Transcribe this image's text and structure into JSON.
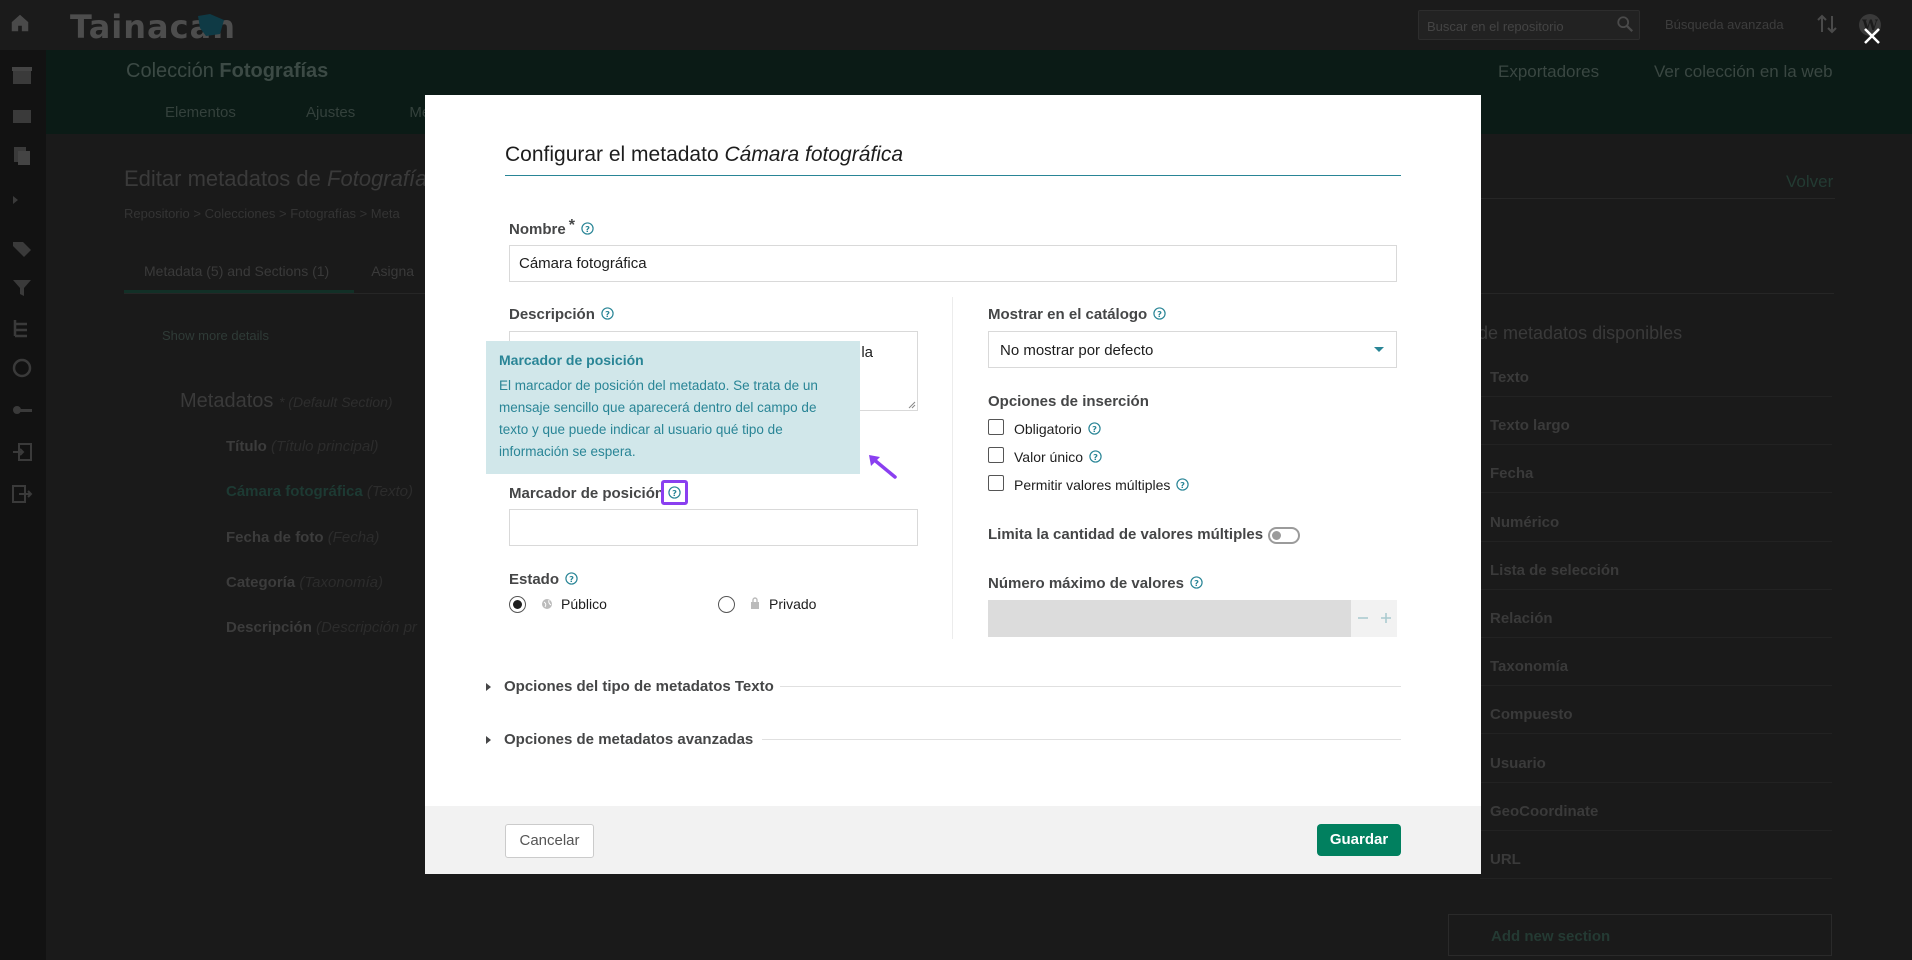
{
  "app": {
    "logo_text": "Tainacan",
    "search_placeholder": "Buscar en el repositorio",
    "advanced_search": "Búsqueda avanzada"
  },
  "collection": {
    "title_prefix": "Colección",
    "title_name": "Fotografías",
    "exporters": "Exportadores",
    "view_web": "Ver colección en la web",
    "tabs": [
      "Elementos",
      "Ajustes",
      "Me"
    ]
  },
  "page": {
    "title_prefix": "Editar metadatos de",
    "title_name": "Fotografía",
    "breadcrumb": "Repositorio  >  Colecciones  >  Fotografías  >  Meta",
    "tab_active": "Metadata (5) and Sections (1)",
    "tab_other": "Asigna",
    "show_more": "Show more details",
    "volver": "Volver",
    "metadata_heading": "Metadatos",
    "metadata_section": "* (Default Section)",
    "metadata_items": [
      {
        "name": "Título",
        "type": "(Título principal)"
      },
      {
        "name": "Cámara fotográfica",
        "type": "(Texto)"
      },
      {
        "name": "Fecha de foto",
        "type": "(Fecha)"
      },
      {
        "name": "Categoría",
        "type": "(Taxonomía)"
      },
      {
        "name": "Descripción",
        "type": "(Descripción pr"
      }
    ],
    "available_heading": "de metadatos disponibles",
    "available_types": [
      "Texto",
      "Texto largo",
      "Fecha",
      "Numérico",
      "Lista de selección",
      "Relación",
      "Taxonomía",
      "Compuesto",
      "Usuario",
      "GeoCoordinate",
      "URL"
    ],
    "add_section": "Add new section"
  },
  "modal": {
    "title_prefix": "Configurar el metadato",
    "title_name": "Cámara fotográfica",
    "name_label": "Nombre",
    "name_required": "*",
    "name_value": "Cámara fotográfica",
    "description_label": "Descripción",
    "description_visible_tail": "la",
    "tooltip_title": "Marcador de posición",
    "tooltip_body": "El marcador de posición del metadato. Se trata de un mensaje sencillo que aparecerá dentro del campo de texto y que puede indicar al usuario qué tipo de información se espera.",
    "placeholder_label": "Marcador de posición",
    "placeholder_value": "",
    "status_label": "Estado",
    "status_public": "Público",
    "status_private": "Privado",
    "status_selected": "Público",
    "catalog_label": "Mostrar en el catálogo",
    "catalog_value": "No mostrar por defecto",
    "insertion_label": "Opciones de inserción",
    "opt_required": "Obligatorio",
    "opt_unique": "Valor único",
    "opt_multiple": "Permitir valores múltiples",
    "limit_label": "Limita la cantidad de valores múltiples",
    "limit_enabled": false,
    "max_values_label": "Número máximo de valores",
    "max_values_value": "",
    "type_options": "Opciones del tipo de metadatos Texto",
    "advanced_options": "Opciones de metadatos avanzadas",
    "cancel": "Cancelar",
    "save": "Guardar"
  },
  "colors": {
    "accent": "#298596",
    "save": "#01805f",
    "tooltip_bg": "#d1e7ea",
    "focus": "#8a3ff0"
  }
}
